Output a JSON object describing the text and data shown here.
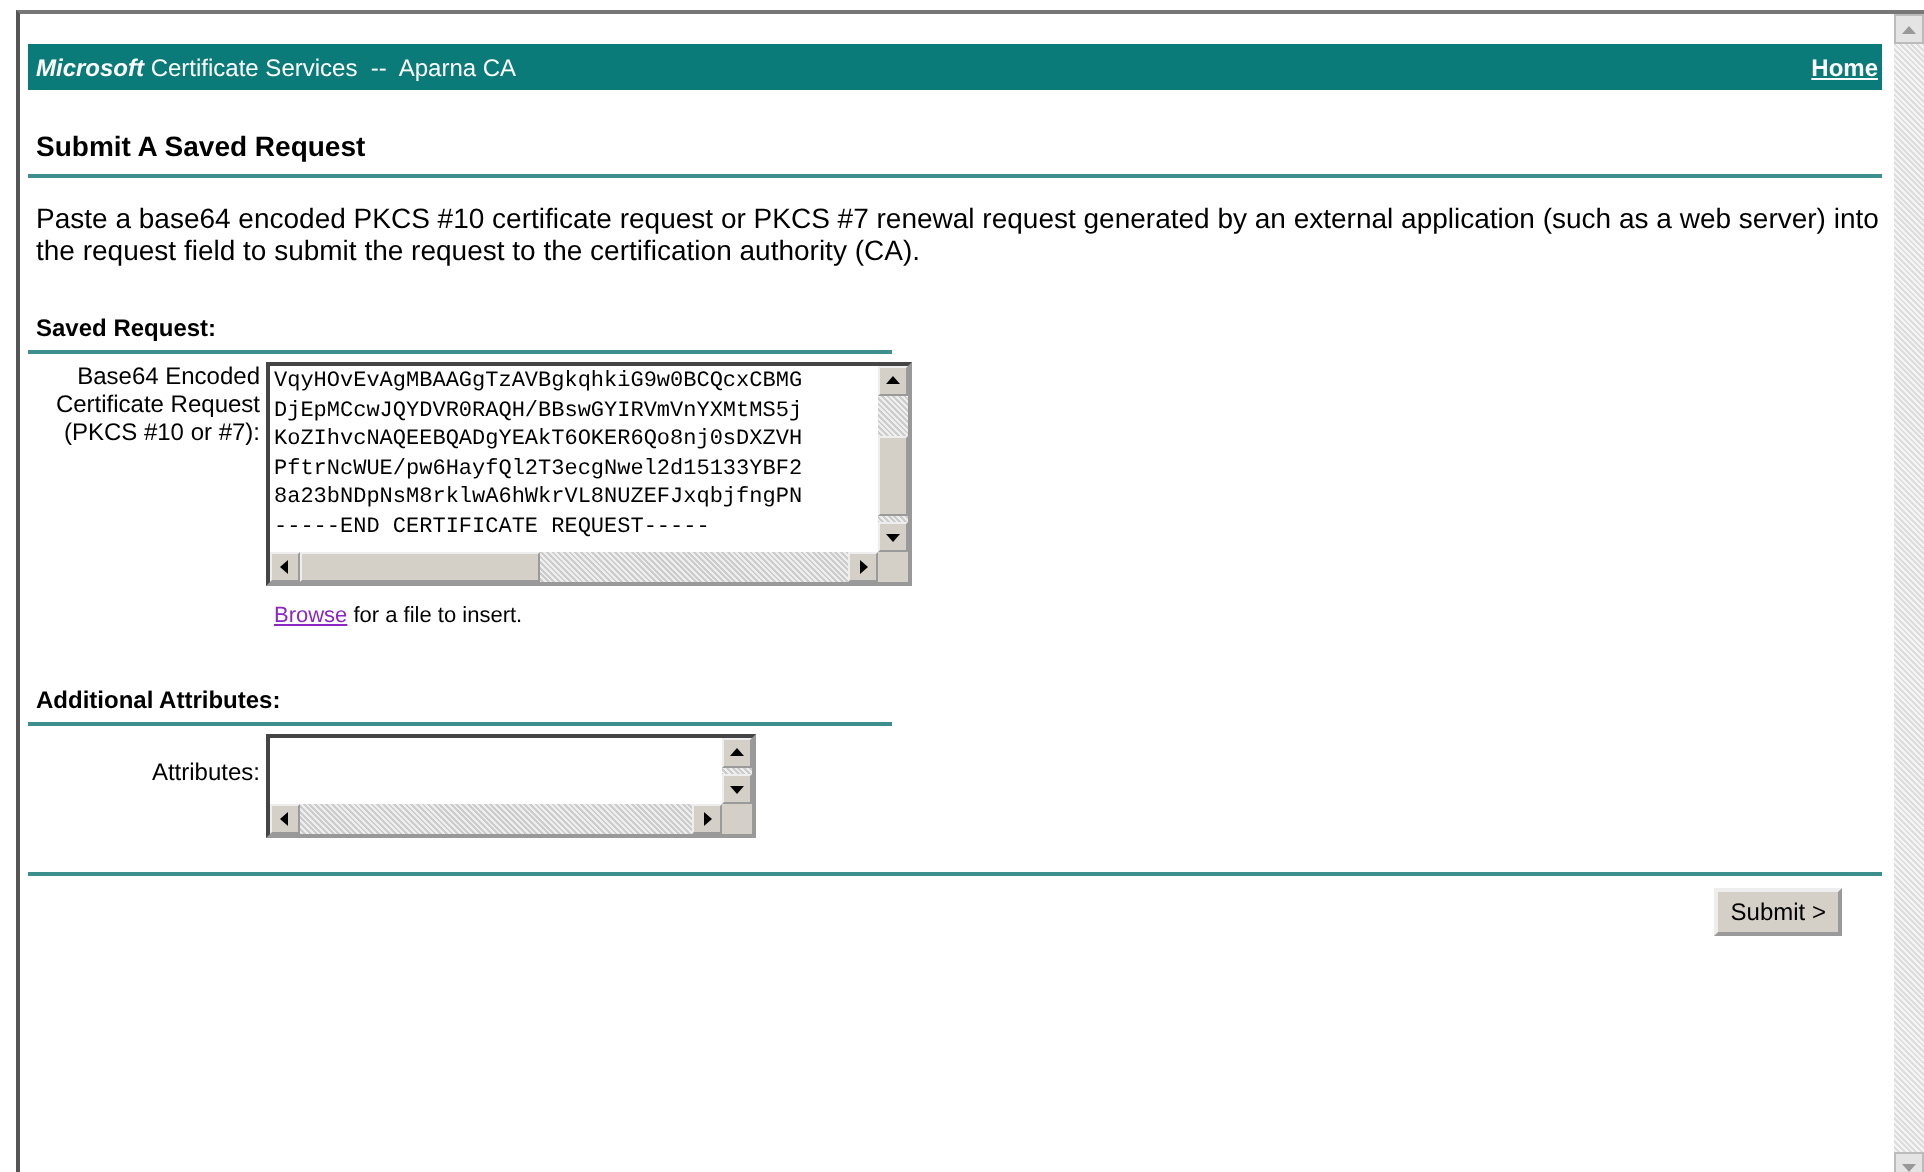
{
  "header": {
    "title": "**Microsoft** Certificate Services  --  Aparna CA",
    "home_link": "Home"
  },
  "page_title": "Submit A Saved Request",
  "intro": "Paste a base64 encoded PKCS #10 certificate request or PKCS #7 renewal request generated by an external application (such as a web server) into the request field to submit the request to the certification authority (CA).",
  "sections": [
    {
      "kind": "request",
      "heading": "Saved Request:",
      "label": "Base64 Encoded Certificate Request (PKCS #10 or #7):",
      "lines": [
        "VqyHOvEvAgMBAAGgTzAVBgkqhkiG9w0BCQcxCBMG",
        "DjEpMCcwJQYDVR0RAQH/BBswGYIRVmVnYXMtMS5j",
        "KoZIhvcNAQEEBQADgYEAkT6OKER6Qo8nj0sDXZVH",
        "PftrNcWUE/pw6HayfQl2T3ecgNwel2d15133YBF2",
        "8a23bNDpNsM8rklwA6hWkrVL8NUZEFJxqbjfngPN",
        "-----END CERTIFICATE REQUEST-----"
      ],
      "browse_link": "Browse",
      "browse_text": " for a file to insert."
    },
    {
      "kind": "attributes",
      "heading": "Additional Attributes:",
      "label": "Attributes:"
    }
  ],
  "submit_button": "Submit >"
}
